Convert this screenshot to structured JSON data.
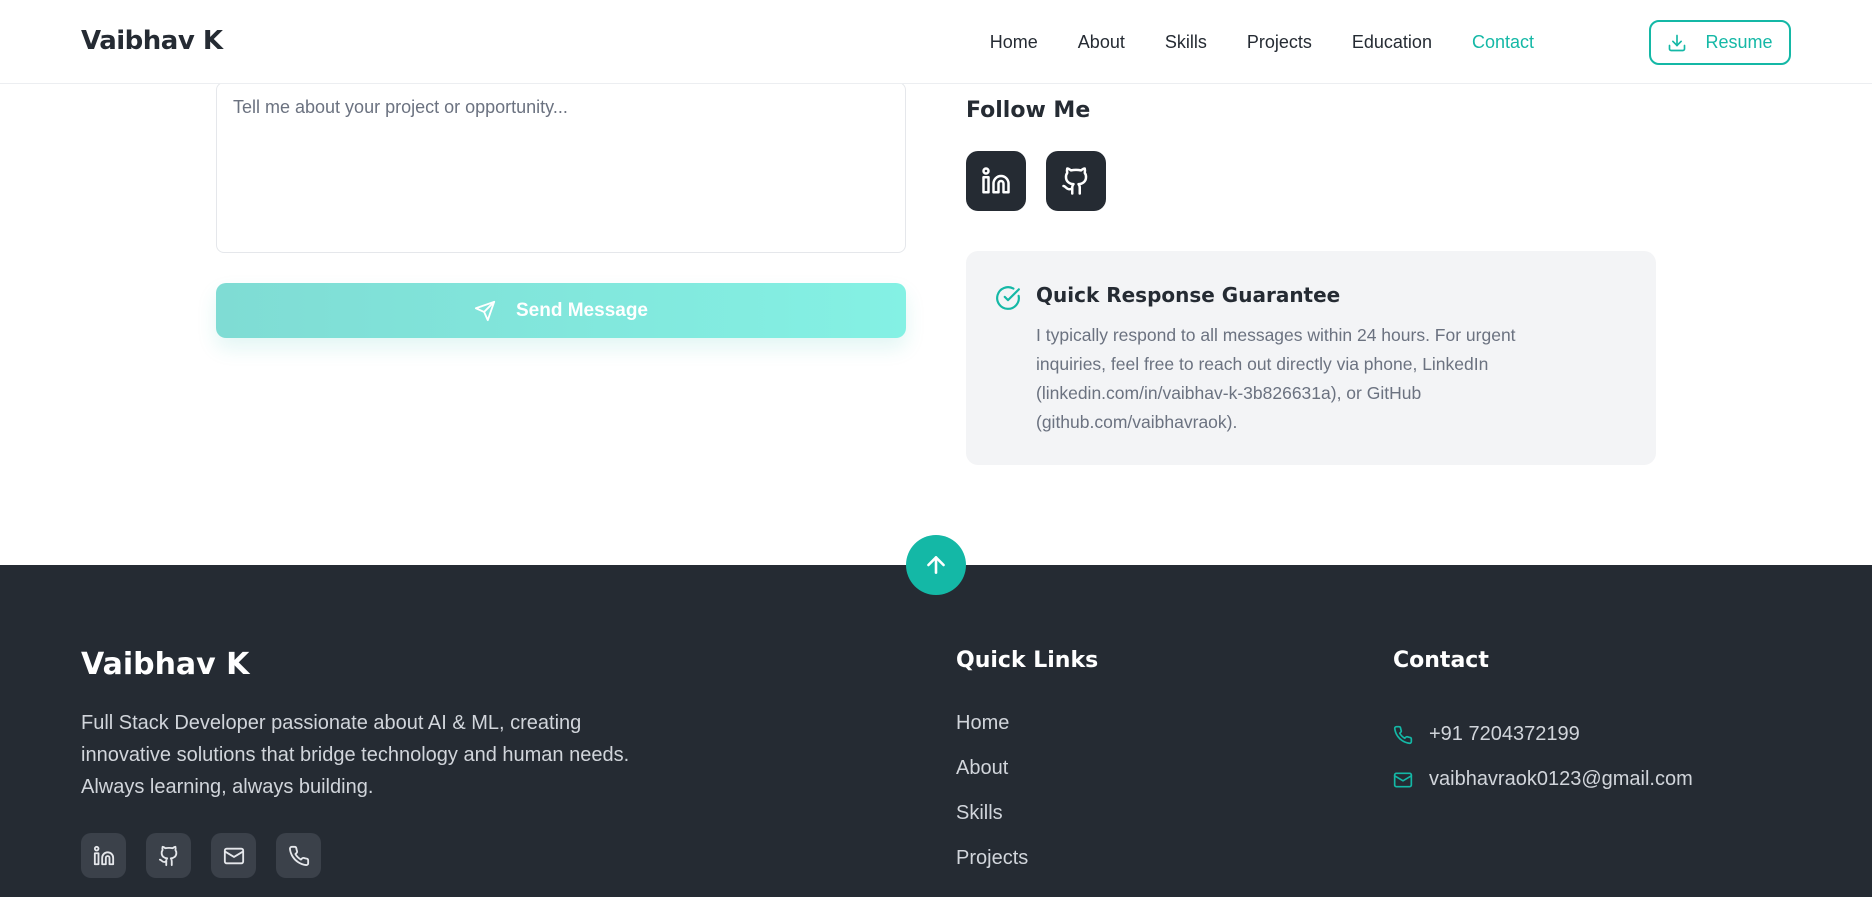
{
  "header": {
    "brand": "Vaibhav K",
    "nav": [
      "Home",
      "About",
      "Skills",
      "Projects",
      "Education",
      "Contact"
    ],
    "active_nav": "Contact",
    "resume_label": "Resume"
  },
  "form": {
    "message_placeholder": "Tell me about your project or opportunity...",
    "send_label": "Send Message"
  },
  "follow": {
    "title": "Follow Me",
    "icons": [
      "linkedin-icon",
      "github-icon"
    ]
  },
  "guarantee": {
    "title": "Quick Response Guarantee",
    "text": "I typically respond to all messages within 24 hours. For urgent inquiries, feel free to reach out directly via phone, LinkedIn (linkedin.com/in/vaibhav-k-3b826631a), or GitHub (github.com/vaibhavraok)."
  },
  "footer": {
    "brand": "Vaibhav K",
    "description": "Full Stack Developer passionate about AI & ML, creating innovative solutions that bridge technology and human needs. Always learning, always building.",
    "social_icons": [
      "linkedin-icon",
      "github-icon",
      "mail-icon",
      "phone-icon"
    ],
    "quick_links_title": "Quick Links",
    "quick_links": [
      "Home",
      "About",
      "Skills",
      "Projects"
    ],
    "contact_title": "Contact",
    "phone": "+91 7204372199",
    "email": "vaibhavraok0123@gmail.com"
  },
  "colors": {
    "accent": "#14b8a6",
    "dark": "#252b33",
    "muted": "#6b7280"
  }
}
